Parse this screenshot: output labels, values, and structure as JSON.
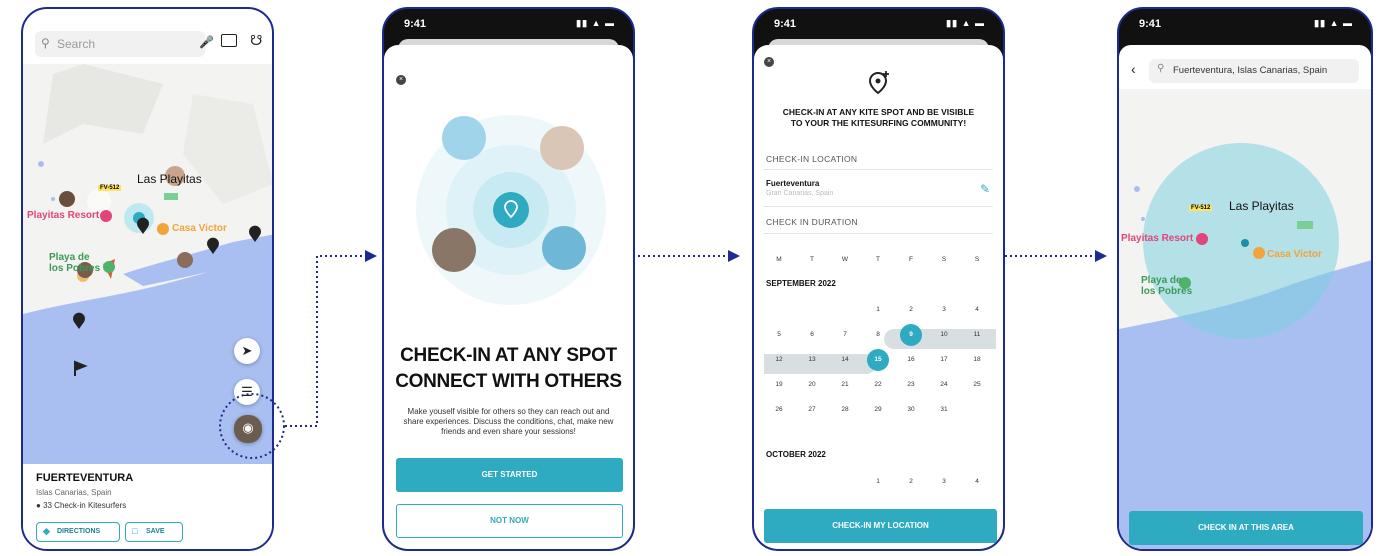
{
  "phone1": {
    "search_placeholder": "Search",
    "map_labels": {
      "route_tag": "FV-512",
      "las_playitas": "Las Playitas",
      "playitas_resort": "Playitas Resort",
      "casa_victor": "Casa Victor",
      "playa_de": "Playa de",
      "los_pobres": "los Pobres"
    },
    "spot": {
      "title": "FUERTEVENTURA",
      "subtitle": "Islas Canarias, Spain",
      "checkins": "33 Check-in Kitesurfers"
    },
    "buttons": {
      "directions": "DIRECTIONS",
      "save": "SAVE"
    }
  },
  "phone2": {
    "time": "9:41",
    "headline_line1": "CHECK-IN AT ANY SPOT",
    "headline_line2": "CONNECT WITH OTHERS",
    "body": "Make youself visible for others so they can reach out and share experiences. Discuss the conditions, chat, make new friends and even share your sessions!",
    "primary_button": "GET STARTED",
    "secondary_button": "NOT NOW"
  },
  "phone3": {
    "time": "9:41",
    "headline_line1": "CHECK-IN AT ANY KITE SPOT AND BE VISIBLE",
    "headline_line2": "TO YOUR THE KITESURFING COMMUNITY!",
    "location_label": "CHECK-IN LOCATION",
    "location_name": "Fuerteventura",
    "location_sub": "Gran Canarias, Spain",
    "duration_label": "CHECK IN DURATION",
    "weekdays": [
      "M",
      "T",
      "W",
      "T",
      "F",
      "S",
      "S"
    ],
    "month1": "SEPTEMBER 2022",
    "month2": "OCTOBER 2022",
    "september_weeks": [
      [
        "",
        "",
        "",
        "1",
        "2",
        "3",
        "4"
      ],
      [
        "5",
        "6",
        "7",
        "8",
        "9",
        "10",
        "11"
      ],
      [
        "12",
        "13",
        "14",
        "15",
        "16",
        "17",
        "18"
      ],
      [
        "19",
        "20",
        "21",
        "22",
        "23",
        "24",
        "25"
      ],
      [
        "26",
        "27",
        "28",
        "29",
        "30",
        "31",
        ""
      ]
    ],
    "october_weeks": [
      [
        "",
        "",
        "",
        "1",
        "2",
        "3",
        "4"
      ]
    ],
    "range_start": "9",
    "range_end": "15",
    "button": "CHECK-IN MY LOCATION"
  },
  "phone4": {
    "time": "9:41",
    "search_value": "Fuerteventura, Islas Canarias, Spain",
    "map_labels": {
      "route_tag": "FV-512",
      "las_playitas": "Las Playitas",
      "playitas_resort": "Playitas Resort",
      "casa_victor": "Casa Victor",
      "playa_de": "Playa de",
      "los_pobres": "los Pobres"
    },
    "button": "CHECK IN AT THIS AREA"
  },
  "colors": {
    "frame": "#1d2a8f",
    "accent": "#2eaac1",
    "sea": "#a9bff2",
    "land": "#f3f3f1",
    "pink": "#e0457b",
    "orange": "#f2a33a",
    "green": "#4fb36c"
  }
}
